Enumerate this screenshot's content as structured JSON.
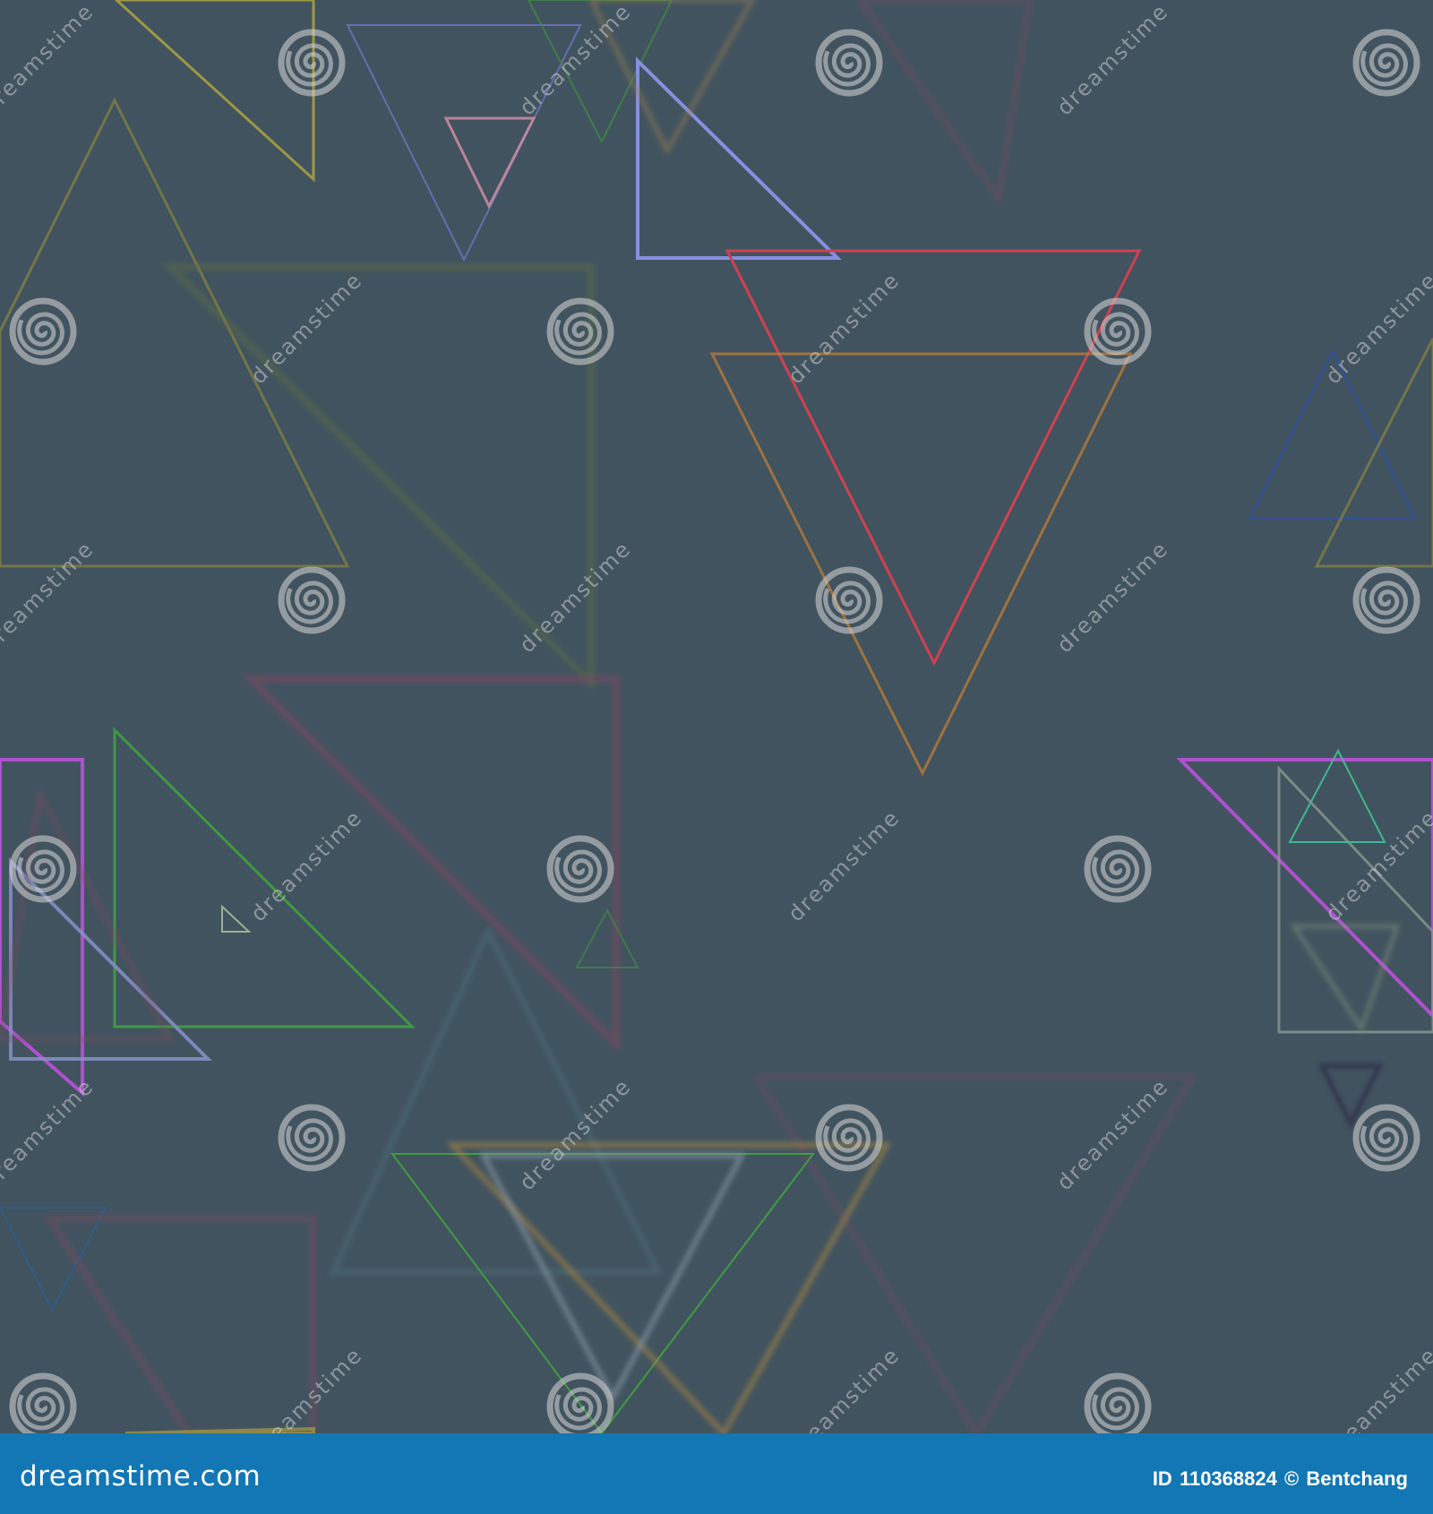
{
  "watermark": {
    "text": "dreamstime",
    "logo_icon": "spiral-logo-icon"
  },
  "footer": {
    "brand": "dreamstime.com",
    "id_label": "ID",
    "id_value": "110368824",
    "copyright_symbol": "©",
    "author": "Bentchang"
  },
  "palette": {
    "background": "#41535f",
    "footer": "#1277b4",
    "accents": [
      "#d14050",
      "#8690e0",
      "#b89050",
      "#b050d0",
      "#40b890",
      "#3050a0",
      "#40a040"
    ]
  }
}
